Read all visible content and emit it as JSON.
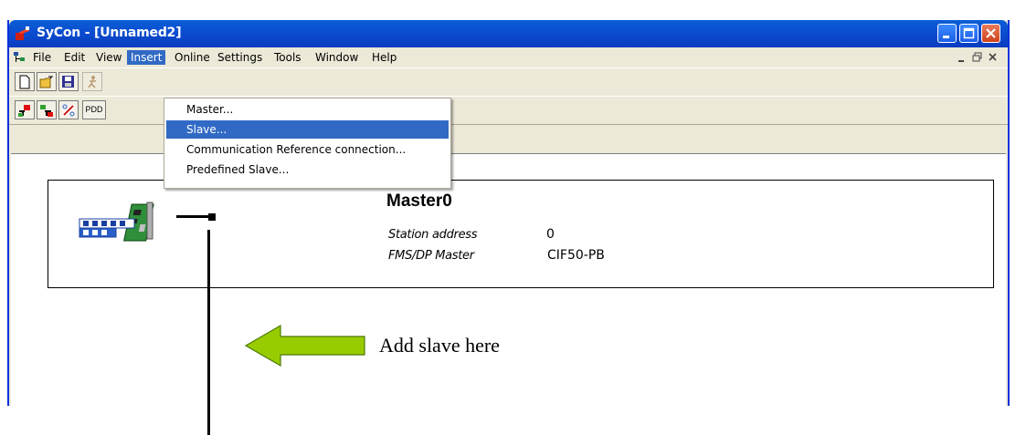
{
  "window": {
    "title": "SyCon - [Unnamed2]"
  },
  "menubar": {
    "items": [
      "File",
      "Edit",
      "View",
      "Insert",
      "Online",
      "Settings",
      "Tools",
      "Window",
      "Help"
    ],
    "active": "Insert"
  },
  "insert_menu": {
    "items": [
      "Master...",
      "Slave...",
      "Communication Reference connection...",
      "Predefined Slave..."
    ],
    "highlighted": "Slave..."
  },
  "toolbar2": {
    "pdd_label": "PDD"
  },
  "master": {
    "name": "Master0",
    "station_address_label": "Station address",
    "station_address_value": "0",
    "type_label": "FMS/DP Master",
    "type_value": "CIF50-PB"
  },
  "annotation": {
    "text": "Add slave here",
    "arrow_color": "#99cc00"
  },
  "colors": {
    "titlebar": "#0b4ed0",
    "menu_highlight": "#316ac5",
    "window_bg": "#ece9d8"
  }
}
